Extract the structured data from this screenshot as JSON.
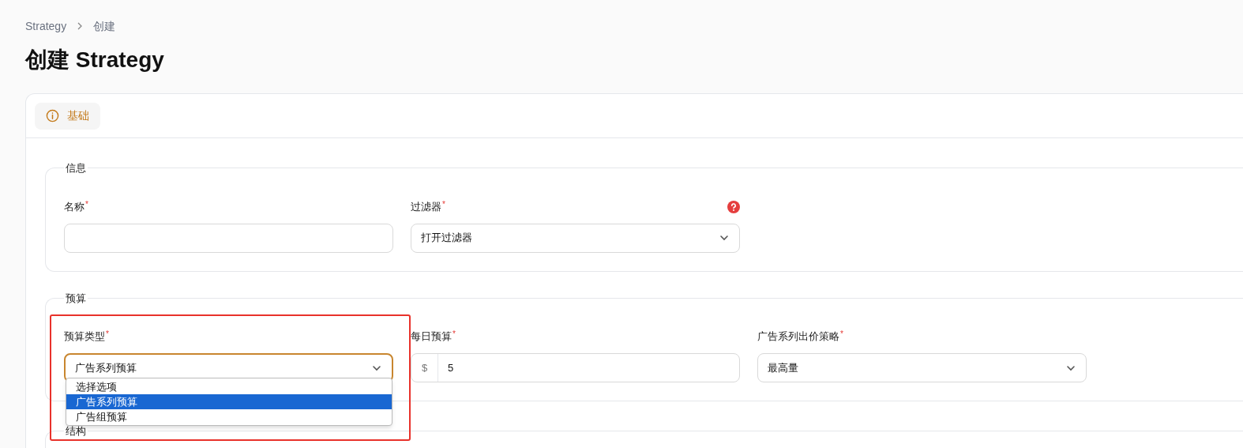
{
  "breadcrumbs": [
    {
      "label": "Strategy"
    },
    {
      "label": "创建"
    }
  ],
  "title": "创建 Strategy",
  "tabs": [
    {
      "label": "基础",
      "selected": true
    }
  ],
  "sections": [
    {
      "legend": "信息",
      "fields": [
        {
          "kind": "text",
          "label": "名称",
          "required": "*"
        },
        {
          "kind": "select",
          "label": "过滤器",
          "required": "*",
          "value": "打开过滤器",
          "help": true
        }
      ]
    },
    {
      "legend": "预算",
      "fields": [
        {
          "kind": "select",
          "label": "预算类型",
          "required": "*",
          "value": "广告系列预算",
          "expanded": true,
          "options": [
            {
              "label": "选择选项",
              "selected": false
            },
            {
              "label": "广告系列预算",
              "selected": true
            },
            {
              "label": "广告组预算",
              "selected": false
            }
          ]
        },
        {
          "kind": "money",
          "label": "每日预算",
          "required": "*",
          "prefix": "$",
          "value": "5"
        },
        {
          "kind": "select",
          "label": "广告系列出价策略",
          "required": "*",
          "value": "最高量"
        }
      ]
    },
    {
      "legend": "结构"
    }
  ]
}
